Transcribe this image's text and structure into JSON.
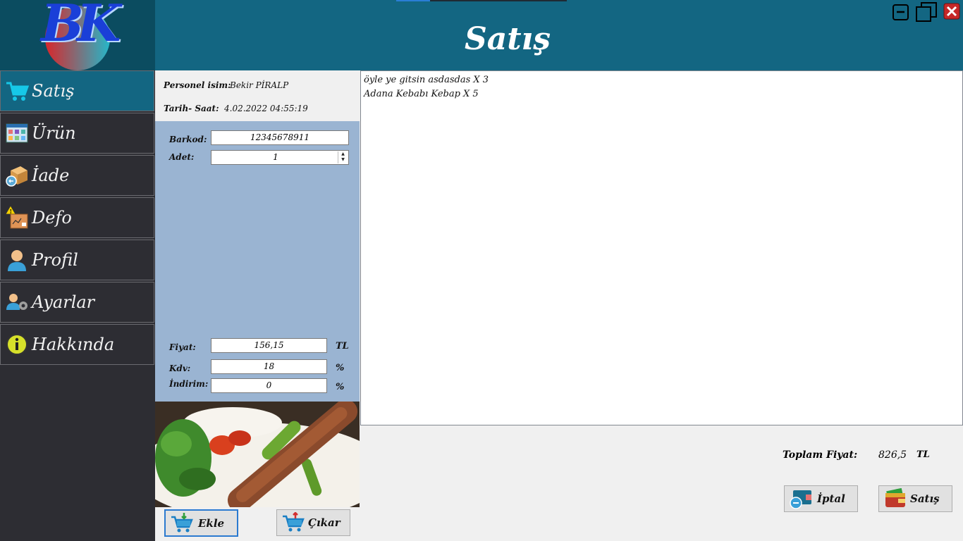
{
  "header": {
    "title": "Satış",
    "logo_text": "BK",
    "progress": 0.2,
    "window_controls": [
      "minimize-icon",
      "restore-icon",
      "close-icon"
    ]
  },
  "sidebar": {
    "items": [
      {
        "label": "Satış",
        "icon": "cart-icon",
        "active": true
      },
      {
        "label": "Ürün",
        "icon": "products-icon",
        "active": false
      },
      {
        "label": "İade",
        "icon": "return-box-icon",
        "active": false
      },
      {
        "label": "Defo",
        "icon": "damaged-box-icon",
        "active": false
      },
      {
        "label": "Profil",
        "icon": "user-icon",
        "active": false
      },
      {
        "label": "Ayarlar",
        "icon": "user-settings-icon",
        "active": false
      },
      {
        "label": "Hakkında",
        "icon": "info-icon",
        "active": false
      }
    ]
  },
  "info": {
    "personnel_label": "Personel isim:",
    "personnel_value": "Bekir PİRALP",
    "datetime_label": "Tarih- Saat:",
    "datetime_value": "4.02.2022 04:55:19"
  },
  "form": {
    "barcode_label": "Barkod:",
    "barcode_value": "12345678911",
    "quantity_label": "Adet:",
    "quantity_value": "1",
    "price_label": "Fiyat:",
    "price_value": "156,15",
    "price_unit": "TL",
    "vat_label": "Kdv:",
    "vat_value": "18",
    "vat_unit": "%",
    "discount_label": "İndirim:",
    "discount_value": "0",
    "discount_unit": "%"
  },
  "buttons": {
    "add": "Ekle",
    "remove": "Çıkar",
    "cancel": "İptal",
    "sell": "Satış"
  },
  "sale_list": [
    "öyle ye gitsin asdasdas X 3",
    "Adana Kebabı Kebap X 5"
  ],
  "total": {
    "label": "Toplam Fiyat:",
    "value": "826,5",
    "currency": "TL"
  },
  "colors": {
    "header": "#136682",
    "sidebar": "#2d2d33",
    "form_panel": "#9ab4d2"
  }
}
